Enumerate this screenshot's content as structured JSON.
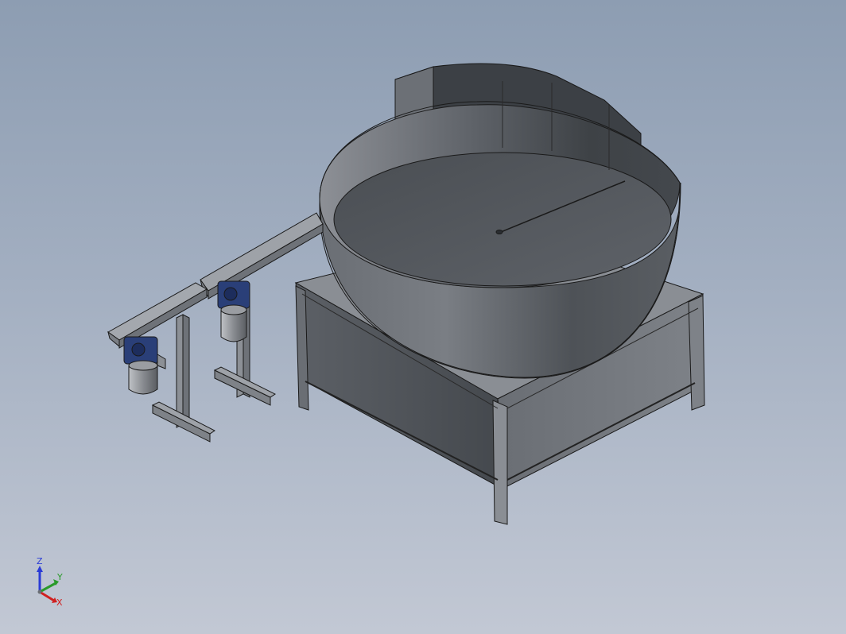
{
  "viewport": {
    "background_top": "#8d9db2",
    "background_bottom": "#c2c8d4"
  },
  "model": {
    "parts": [
      "circular-hopper",
      "support-frame",
      "belt-conveyor-1",
      "belt-conveyor-2",
      "gear-motor-1",
      "gear-motor-2"
    ],
    "colors": {
      "steel": "#6e7278",
      "motor_blue": "#2a3f78",
      "edge": "#1a1a1a"
    }
  },
  "triad": {
    "z_label": "Z",
    "y_label": "Y",
    "x_label": "X",
    "z_color": "#2a3bd6",
    "y_color": "#2a9a2a",
    "x_color": "#d02020"
  }
}
